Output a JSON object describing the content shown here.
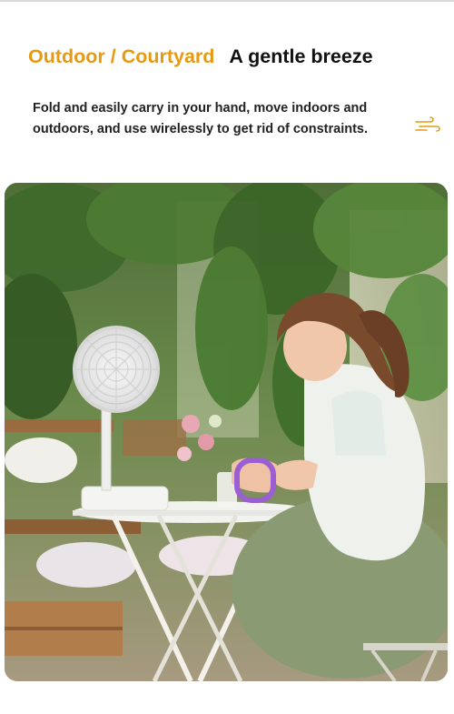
{
  "header": {
    "title_accent": "Outdoor / Courtyard",
    "title_main": "A gentle breeze",
    "description": "Fold and easily carry in your hand, move indoors and outdoors, and use wirelessly to get rid of constraints."
  },
  "icons": {
    "breeze": "wind-icon"
  },
  "colors": {
    "accent": "#e59a12",
    "text": "#111111"
  }
}
